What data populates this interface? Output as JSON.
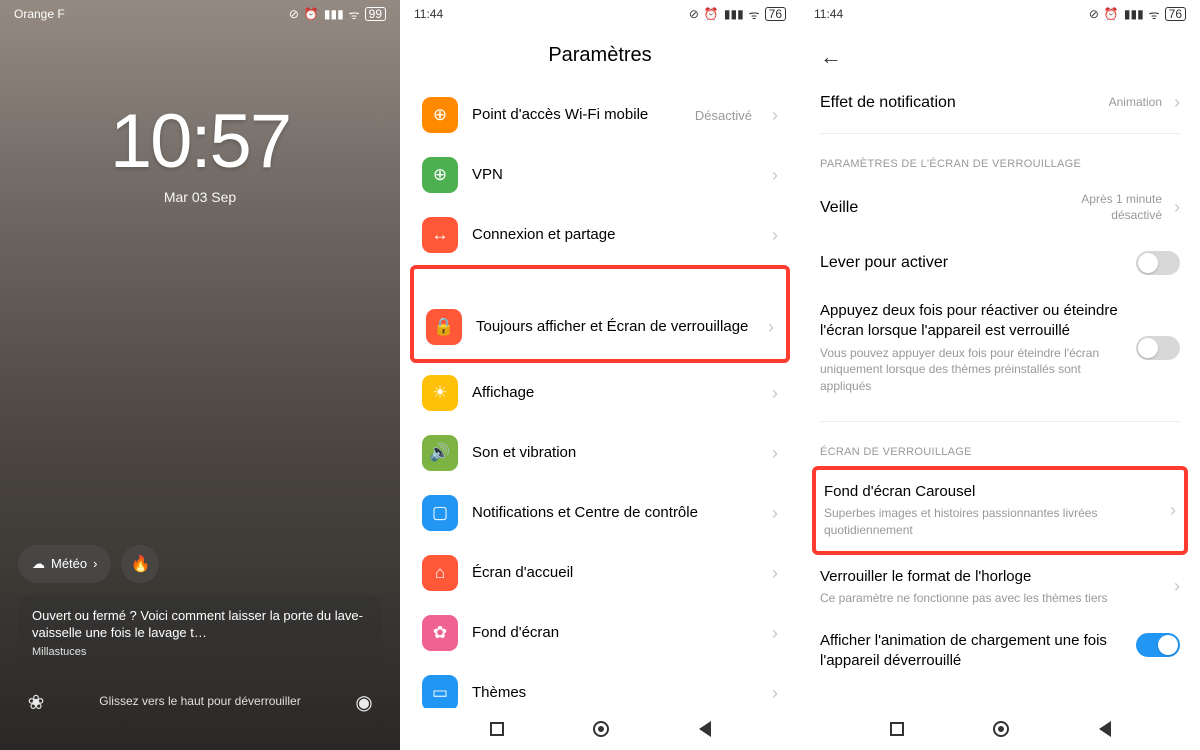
{
  "phone1": {
    "status_left": "Orange F",
    "battery": "99",
    "clock": "10:57",
    "date": "Mar 03 Sep",
    "weather_label": "Météo",
    "weather_arrow": "›",
    "flame": "🔥",
    "notification": {
      "text": "Ouvert ou fermé ? Voici comment laisser la porte du lave-vaisselle une fois le lavage t…",
      "source": "Millastuces"
    },
    "swipe_hint": "Glissez vers le haut pour déverrouiller"
  },
  "phone2": {
    "time": "11:44",
    "battery": "76",
    "title": "Paramètres",
    "items": [
      {
        "icon": "⊕",
        "color": "icon-orange",
        "label": "Point d'accès Wi-Fi mobile",
        "value": "Désactivé"
      },
      {
        "icon": "⊕",
        "color": "icon-green",
        "label": "VPN",
        "value": ""
      },
      {
        "icon": "↔",
        "color": "icon-red",
        "label": "Connexion et partage",
        "value": ""
      },
      {
        "icon": "🔒",
        "color": "icon-red",
        "label": "Toujours afficher et Écran de verrouillage",
        "value": "",
        "spaced": true,
        "highlighted": true
      },
      {
        "icon": "☀",
        "color": "icon-yellow",
        "label": "Affichage",
        "value": ""
      },
      {
        "icon": "🔊",
        "color": "icon-lgreen",
        "label": "Son et vibration",
        "value": ""
      },
      {
        "icon": "▢",
        "color": "icon-blue",
        "label": "Notifications et Centre de contrôle",
        "value": ""
      },
      {
        "icon": "⌂",
        "color": "icon-red",
        "label": "Écran d'accueil",
        "value": ""
      },
      {
        "icon": "✿",
        "color": "icon-pink",
        "label": "Fond d'écran",
        "value": ""
      },
      {
        "icon": "▭",
        "color": "icon-blue",
        "label": "Thèmes",
        "value": ""
      }
    ]
  },
  "phone3": {
    "time": "11:44",
    "battery": "76",
    "notif_effect": {
      "label": "Effet de notification",
      "value": "Animation"
    },
    "section1": "PARAMÈTRES DE L'ÉCRAN DE VERROUILLAGE",
    "sleep": {
      "label": "Veille",
      "value": "Après 1 minute désactivé"
    },
    "raise": {
      "label": "Lever pour activer"
    },
    "doubletap": {
      "title": "Appuyez deux fois pour réactiver ou éteindre l'écran lorsque l'appareil est verrouillé",
      "desc": "Vous pouvez appuyer deux fois pour éteindre l'écran uniquement lorsque des thèmes préinstallés sont appliqués"
    },
    "section2": "ÉCRAN DE VERROUILLAGE",
    "carousel": {
      "title": "Fond d'écran Carousel",
      "desc": "Superbes images et histoires passionnantes livrées quotidiennement"
    },
    "lockclock": {
      "title": "Verrouiller le format de l'horloge",
      "desc": "Ce paramètre ne fonctionne pas avec les thèmes tiers"
    },
    "charging": {
      "title": "Afficher l'animation de chargement une fois l'appareil déverrouillé"
    }
  }
}
